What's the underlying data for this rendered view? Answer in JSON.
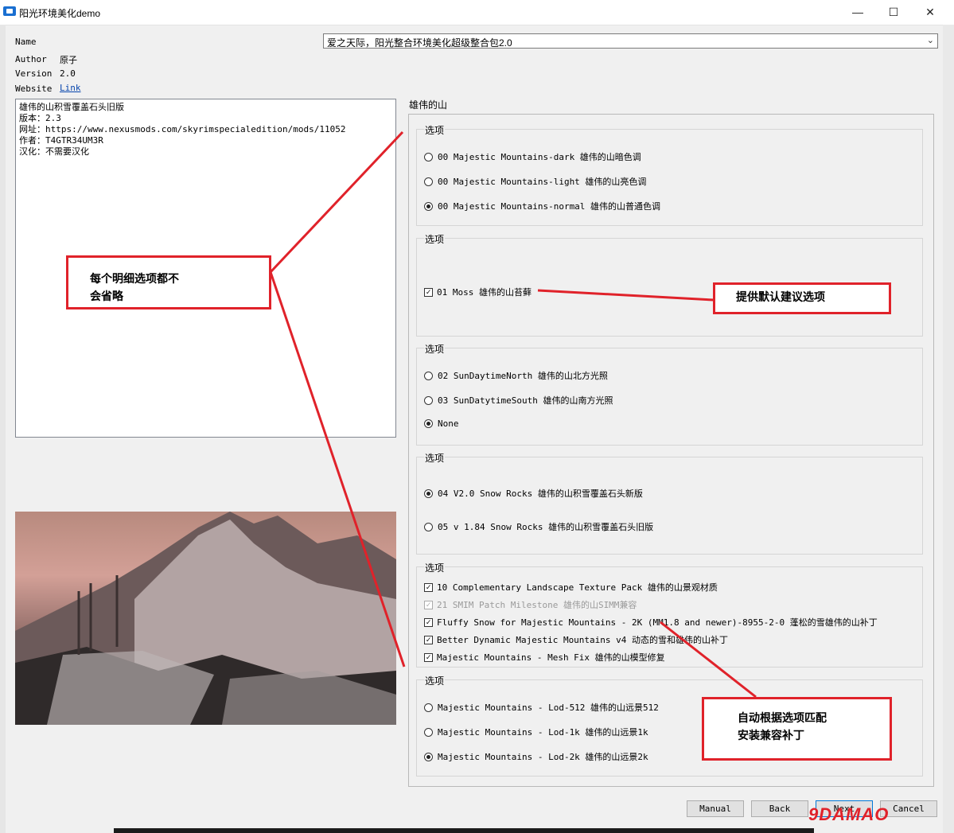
{
  "window": {
    "title": "阳光环境美化demo",
    "minimize": "—",
    "maximize": "☐",
    "close": "✕"
  },
  "info": {
    "name_label": "Name",
    "name_value": "爱之天际，阳光整合环境美化超级整合包2.0",
    "author_label": "Author",
    "author_value": "原子",
    "version_label": "Version",
    "version_value": "2.0",
    "website_label": "Website",
    "website_value": "Link"
  },
  "description": {
    "lines": [
      "雄伟的山积雪覆盖石头旧版",
      "版本：2.3",
      "网址：https://www.nexusmods.com/skyrimspecialedition/mods/11052",
      "作者：T4GTR34UM3R",
      "汉化：不需要汉化"
    ]
  },
  "page_title": "雄伟的山",
  "groups": [
    {
      "title": "选项",
      "options": [
        {
          "kind": "radio",
          "checked": false,
          "label": "00 Majestic Mountains-dark 雄伟的山暗色调"
        },
        {
          "kind": "radio",
          "checked": false,
          "label": "00 Majestic Mountains-light 雄伟的山亮色调"
        },
        {
          "kind": "radio",
          "checked": true,
          "label": "00 Majestic Mountains-normal 雄伟的山普通色调"
        }
      ]
    },
    {
      "title": "选项",
      "options": [
        {
          "kind": "check",
          "checked": true,
          "label": "01 Moss 雄伟的山苔藓"
        }
      ]
    },
    {
      "title": "选项",
      "options": [
        {
          "kind": "radio",
          "checked": false,
          "label": "02 SunDaytimeNorth 雄伟的山北方光照"
        },
        {
          "kind": "radio",
          "checked": false,
          "label": "03 SunDatytimeSouth 雄伟的山南方光照"
        },
        {
          "kind": "radio",
          "checked": true,
          "label": "None"
        }
      ]
    },
    {
      "title": "选项",
      "options": [
        {
          "kind": "radio",
          "checked": true,
          "label": "04 V2.0 Snow Rocks 雄伟的山积雪覆盖石头新版"
        },
        {
          "kind": "radio",
          "checked": false,
          "label": "05 v 1.84 Snow Rocks 雄伟的山积雪覆盖石头旧版"
        }
      ]
    },
    {
      "title": "选项",
      "options": [
        {
          "kind": "check",
          "checked": true,
          "label": "10 Complementary Landscape Texture Pack 雄伟的山景观材质"
        },
        {
          "kind": "check",
          "checked": true,
          "disabled": true,
          "label": "21 SMIM Patch Milestone 雄伟的山SIMM兼容"
        },
        {
          "kind": "check",
          "checked": true,
          "label": "Fluffy Snow for Majestic Mountains - 2K (MM1.8 and newer)-8955-2-0 蓬松的雪雄伟的山补丁"
        },
        {
          "kind": "check",
          "checked": true,
          "label": "Better Dynamic Majestic Mountains v4 动态的雪和雄伟的山补丁"
        },
        {
          "kind": "check",
          "checked": true,
          "label": "Majestic Mountains - Mesh Fix 雄伟的山模型修复"
        }
      ]
    },
    {
      "title": "选项",
      "options": [
        {
          "kind": "radio",
          "checked": false,
          "label": "Majestic Mountains - Lod-512 雄伟的山远景512"
        },
        {
          "kind": "radio",
          "checked": false,
          "label": "Majestic Mountains - Lod-1k 雄伟的山远景1k"
        },
        {
          "kind": "radio",
          "checked": true,
          "label": "Majestic Mountains - Lod-2k 雄伟的山远景2k"
        }
      ]
    }
  ],
  "buttons": {
    "manual": "Manual",
    "back": "Back",
    "next": "Next",
    "cancel": "Cancel"
  },
  "callouts": {
    "c1_line1": "每个明细选项都不",
    "c1_line2": "会省略",
    "c2": "提供默认建议选项",
    "c3_line1": "自动根据选项匹配",
    "c3_line2": "安装兼容补丁"
  },
  "watermark": "9DAMAO",
  "colors": {
    "annotation_red": "#e0222a",
    "link_blue": "#0645ad"
  }
}
